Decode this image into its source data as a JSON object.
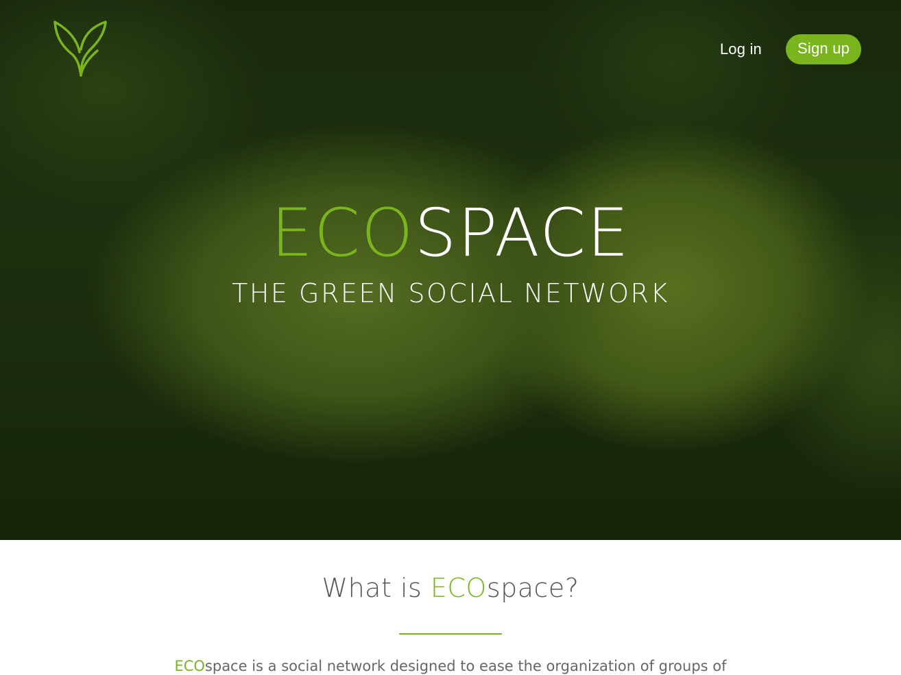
{
  "header": {
    "logo_icon": "leaf-icon",
    "nav": {
      "login_label": "Log in",
      "signup_label": "Sign up"
    }
  },
  "hero": {
    "title_eco": "ECO",
    "title_space": "SPACE",
    "subtitle": "THE GREEN SOCIAL NETWORK"
  },
  "about": {
    "title_prefix": "What is ",
    "title_eco": "ECO",
    "title_suffix": "space?",
    "text_eco": "ECO",
    "text_rest": "space is a social network designed to ease the organization of groups of"
  },
  "colors": {
    "accent": "#7ab51d",
    "text_dark": "#555555",
    "text_body": "#666666"
  }
}
